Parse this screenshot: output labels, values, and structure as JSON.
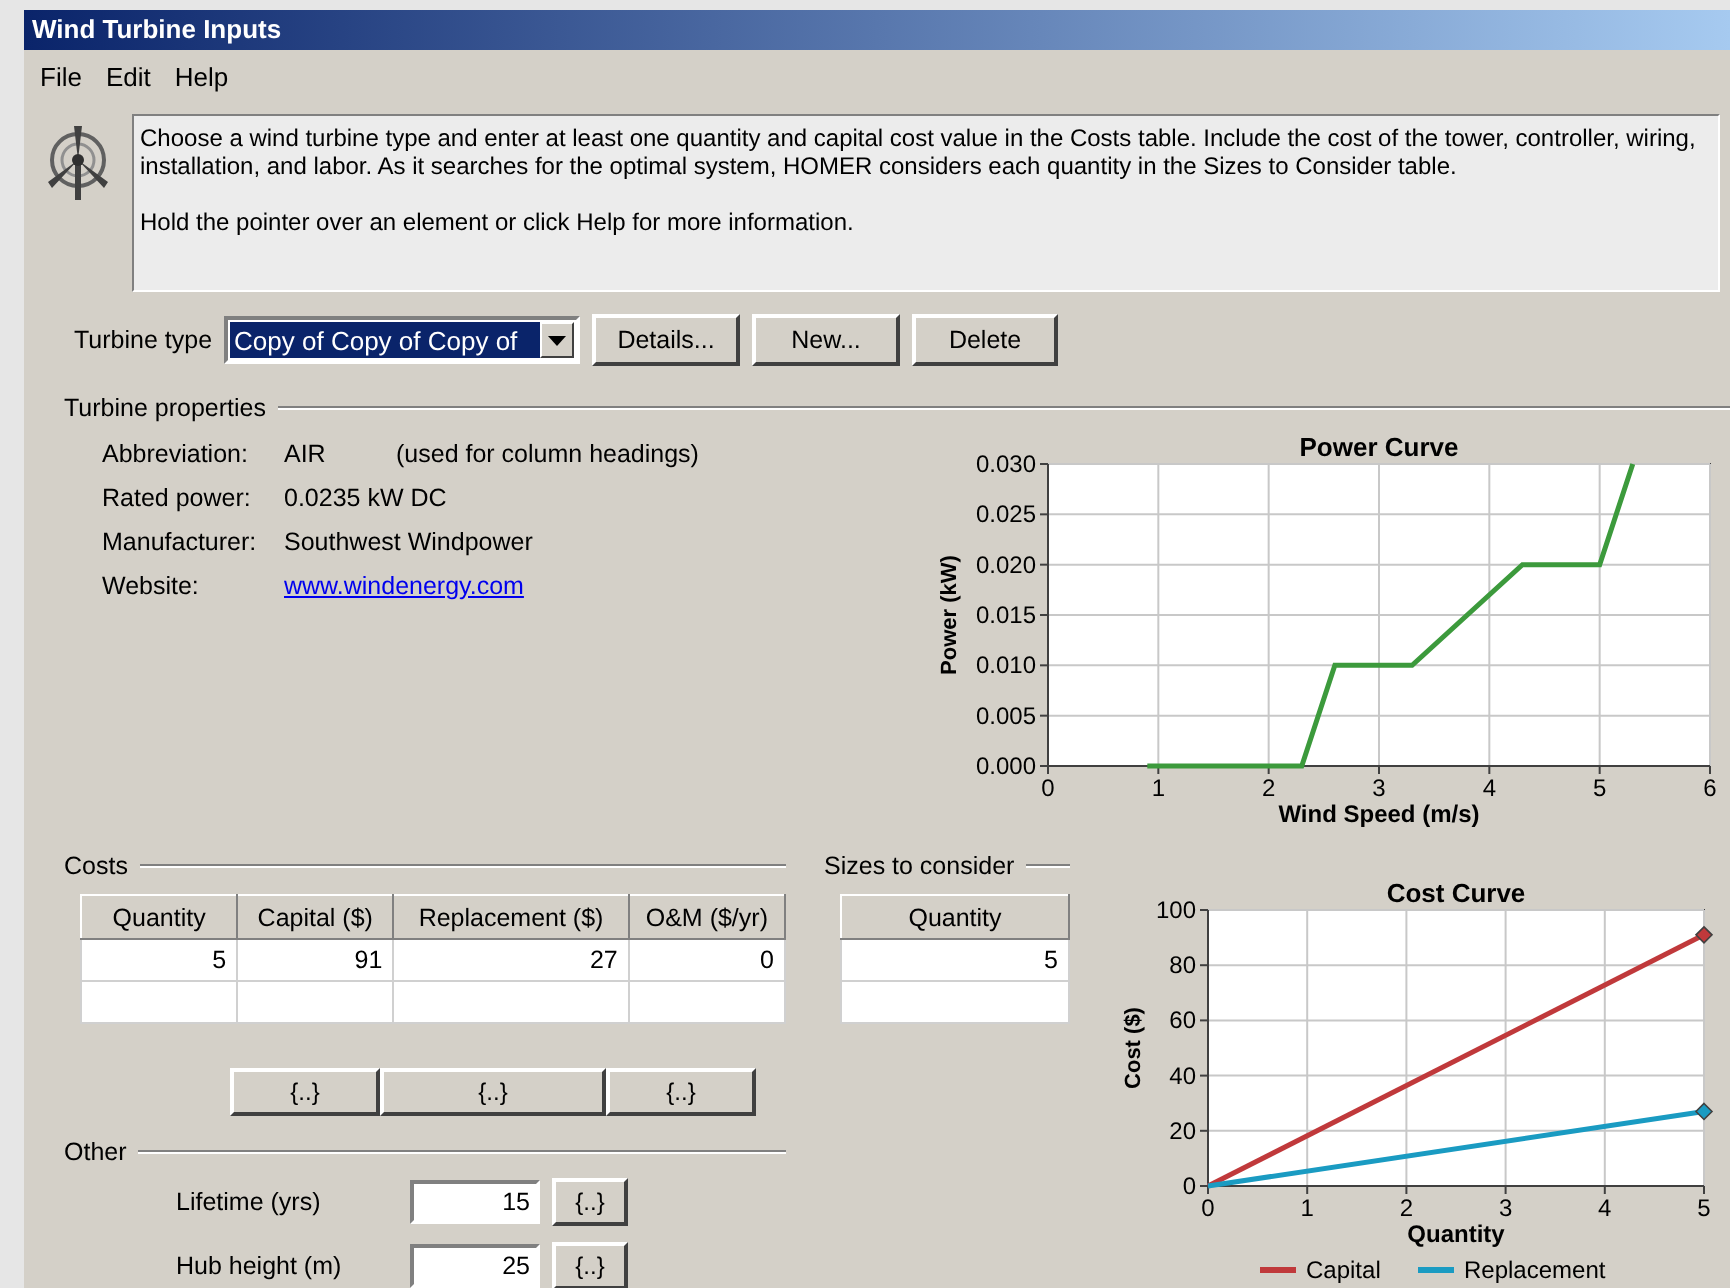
{
  "window": {
    "title": "Wind Turbine Inputs"
  },
  "menu": [
    "File",
    "Edit",
    "Help"
  ],
  "info": {
    "paragraphs": [
      "Choose a wind turbine type and enter at least one quantity and capital cost value in the Costs table. Include the cost of the tower, controller, wiring, installation, and labor. As it searches for the optimal system, HOMER considers each quantity in the Sizes to Consider table.",
      "Hold the pointer over an element or click Help for more information."
    ]
  },
  "turbine_type": {
    "label": "Turbine type",
    "value": "Copy of Copy of Copy of"
  },
  "buttons": [
    "Details...",
    "New...",
    "Delete"
  ],
  "properties": {
    "title": "Turbine properties",
    "rows": [
      {
        "kind": "text",
        "label": "Abbreviation:",
        "value": "AIR",
        "note": "(used for column headings)"
      },
      {
        "kind": "text",
        "label": "Rated power:",
        "value": "0.0235 kW DC"
      },
      {
        "kind": "text",
        "label": "Manufacturer:",
        "value": "Southwest Windpower"
      },
      {
        "kind": "link",
        "label": "Website:",
        "value": "www.windenergy.com"
      }
    ]
  },
  "power_curve": {
    "chart_data": {
      "type": "line",
      "title": "Power Curve",
      "xlabel": "Wind Speed (m/s)",
      "ylabel": "Power (kW)",
      "x": [
        0.9,
        2.3,
        2.6,
        3.3,
        4.3,
        5.0,
        5.3
      ],
      "series": [
        {
          "color": "#3c9a3c",
          "values": [
            0,
            0,
            0.01,
            0.01,
            0.02,
            0.02,
            0.03
          ]
        }
      ],
      "xlim": [
        0,
        6
      ],
      "ylim": [
        0,
        0.03
      ],
      "grid": true,
      "xticks": [
        0,
        1,
        2,
        3,
        4,
        5,
        6
      ],
      "yticks": [
        {
          "value": 0,
          "label": "0.000"
        },
        {
          "value": 0.005,
          "label": "0.005"
        },
        {
          "value": 0.01,
          "label": "0.010"
        },
        {
          "value": 0.015,
          "label": "0.015"
        },
        {
          "value": 0.02,
          "label": "0.020"
        },
        {
          "value": 0.025,
          "label": "0.025"
        },
        {
          "value": 0.03,
          "label": "0.030"
        }
      ]
    }
  },
  "costs": {
    "title": "Costs",
    "columns": [
      "Quantity",
      "Capital ($)",
      "Replacement ($)",
      "O&M ($/yr)"
    ],
    "rows": [
      [
        "5",
        "91",
        "27",
        "0"
      ]
    ],
    "buttons": [
      "{..}",
      "{..}",
      "{..}"
    ]
  },
  "sizes": {
    "title": "Sizes to consider",
    "columns": [
      "Quantity"
    ],
    "rows": [
      [
        "5"
      ]
    ]
  },
  "other": {
    "title": "Other",
    "fields": [
      {
        "label": "Lifetime (yrs)",
        "value": "15",
        "button": "{..}"
      },
      {
        "label": "Hub height (m)",
        "value": "25",
        "button": "{..}"
      }
    ]
  },
  "cost_curve": {
    "chart_data": {
      "type": "line",
      "title": "Cost Curve",
      "xlabel": "Quantity",
      "ylabel": "Cost ($)",
      "x": [
        0,
        5
      ],
      "series": [
        {
          "name": "Capital",
          "color": "#c0393b",
          "values": [
            0,
            91
          ]
        },
        {
          "name": "Replacement",
          "color": "#1a9bc2",
          "values": [
            0,
            27
          ]
        }
      ],
      "xlim": [
        0,
        5
      ],
      "ylim": [
        0,
        100
      ],
      "grid": true,
      "legend": "bottom",
      "xticks": [
        0,
        1,
        2,
        3,
        4,
        5
      ],
      "yticks": [
        0,
        20,
        40,
        60,
        80,
        100
      ]
    }
  }
}
